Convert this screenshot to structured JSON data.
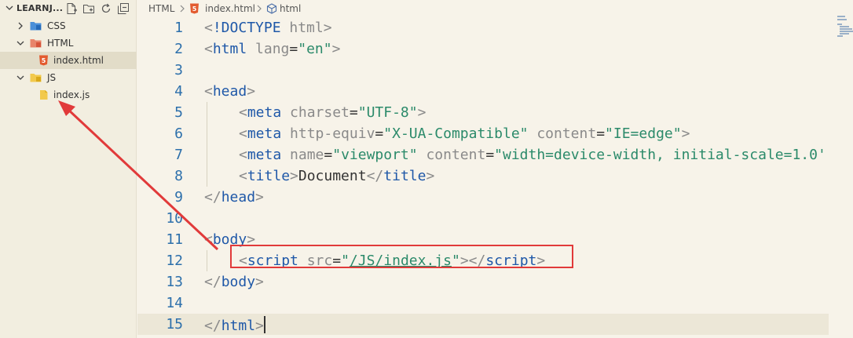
{
  "sidebar": {
    "title": "LEARNJ...",
    "actions": [
      {
        "icon": "new-file-icon"
      },
      {
        "icon": "new-folder-icon"
      },
      {
        "icon": "refresh-icon"
      },
      {
        "icon": "collapse-all-icon"
      }
    ],
    "tree": [
      {
        "label": "CSS",
        "type": "folder",
        "expanded": false,
        "icon": "css-folder-icon"
      },
      {
        "label": "HTML",
        "type": "folder",
        "expanded": true,
        "icon": "html-folder-icon"
      },
      {
        "label": "index.html",
        "type": "file",
        "selected": true,
        "icon": "html5-file-icon"
      },
      {
        "label": "JS",
        "type": "folder",
        "expanded": true,
        "icon": "js-folder-icon"
      },
      {
        "label": "index.js",
        "type": "file",
        "selected": false,
        "icon": "js-file-icon"
      }
    ]
  },
  "breadcrumb": {
    "items": [
      "HTML",
      "index.html",
      "html"
    ],
    "icons": [
      "html5-file-icon",
      "element-cube-icon"
    ]
  },
  "editor": {
    "current_line": 15,
    "lines": [
      {
        "n": "1"
      },
      {
        "n": "2"
      },
      {
        "n": "3"
      },
      {
        "n": "4"
      },
      {
        "n": "5"
      },
      {
        "n": "6"
      },
      {
        "n": "7"
      },
      {
        "n": "8"
      },
      {
        "n": "9"
      },
      {
        "n": "10"
      },
      {
        "n": "11"
      },
      {
        "n": "12"
      },
      {
        "n": "13"
      },
      {
        "n": "14"
      },
      {
        "n": "15"
      }
    ],
    "tokens": {
      "l1": [
        "<",
        "!DOCTYPE",
        " html",
        ">"
      ],
      "l2": [
        "<",
        "html",
        " lang",
        "=",
        "\"en\"",
        ">"
      ],
      "l4": [
        "<",
        "head",
        ">"
      ],
      "l5": [
        "<",
        "meta",
        " charset",
        "=",
        "\"UTF-8\"",
        ">"
      ],
      "l6": [
        "<",
        "meta",
        " http-equiv",
        "=",
        "\"X-UA-Compatible\"",
        " content",
        "=",
        "\"IE=edge\"",
        ">"
      ],
      "l7": [
        "<",
        "meta",
        " name",
        "=",
        "\"viewport\"",
        " content",
        "=",
        "\"width=device-width, initial-scale=1.0'"
      ],
      "l8": [
        "<",
        "title",
        ">",
        "Document",
        "</",
        "title",
        ">"
      ],
      "l9": [
        "</",
        "head",
        ">"
      ],
      "l11": [
        "<",
        "body",
        ">"
      ],
      "l12": [
        "<",
        "script",
        " src",
        "=",
        "\"",
        "/JS/index.js",
        "\"",
        ">",
        "</",
        "script",
        ">"
      ],
      "l13": [
        "</",
        "body",
        ">"
      ],
      "l15": [
        "</",
        "html",
        ">"
      ]
    }
  },
  "colors": {
    "tag": "#1f58a8",
    "bracket": "#8a8a8a",
    "attribute": "#8a8a8a",
    "string": "#2b8a6a",
    "annotation": "#e13a3a",
    "line_number": "#2c6fab"
  }
}
